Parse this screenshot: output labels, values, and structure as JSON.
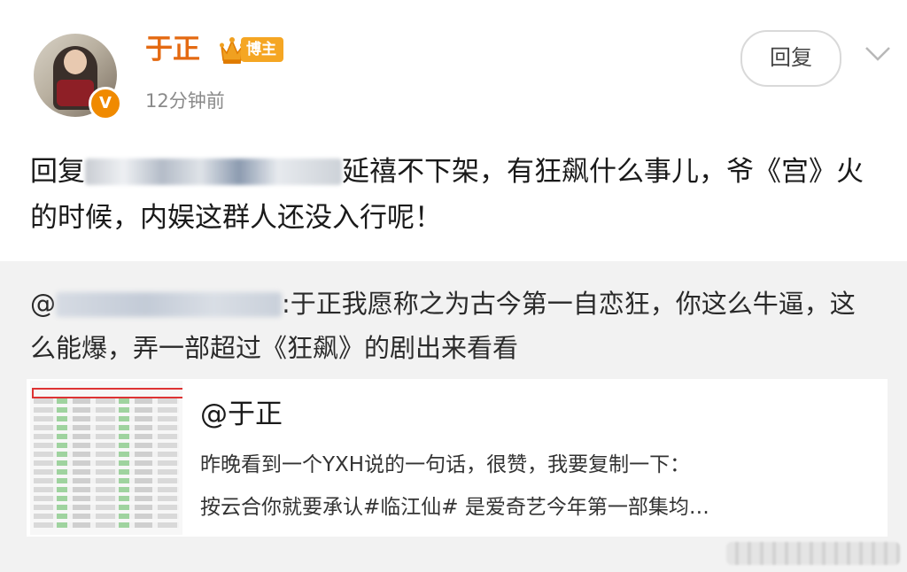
{
  "post": {
    "author": "于正",
    "badge": "博主",
    "time": "12分钟前",
    "reply_button": "回复",
    "text_prefix": "回复",
    "text_rest": "延禧不下架，有狂飙什么事儿，爷《宫》火的时候，内娱这群人还没入行呢！"
  },
  "quote": {
    "at": "@",
    "text": ":于正我愿称之为古今第一自恋狂，你这么牛逼，这么能爆，弄一部超过《狂飙》的剧出来看看"
  },
  "card": {
    "title": "@于正",
    "line1": "昨晚看到一个YXH说的一句话，很赞，我要复制一下：",
    "line2": "按云合你就要承认#临江仙# 是爱奇艺今年第一部集均…"
  },
  "icons": {
    "verified": "verified-v-icon",
    "crown": "crown-icon",
    "chevron": "chevron-down-icon"
  },
  "colors": {
    "author_name": "#e46a12",
    "badge_bg": "#f5a623",
    "verified": "#f08a00",
    "quote_bg": "#f2f2f2"
  }
}
